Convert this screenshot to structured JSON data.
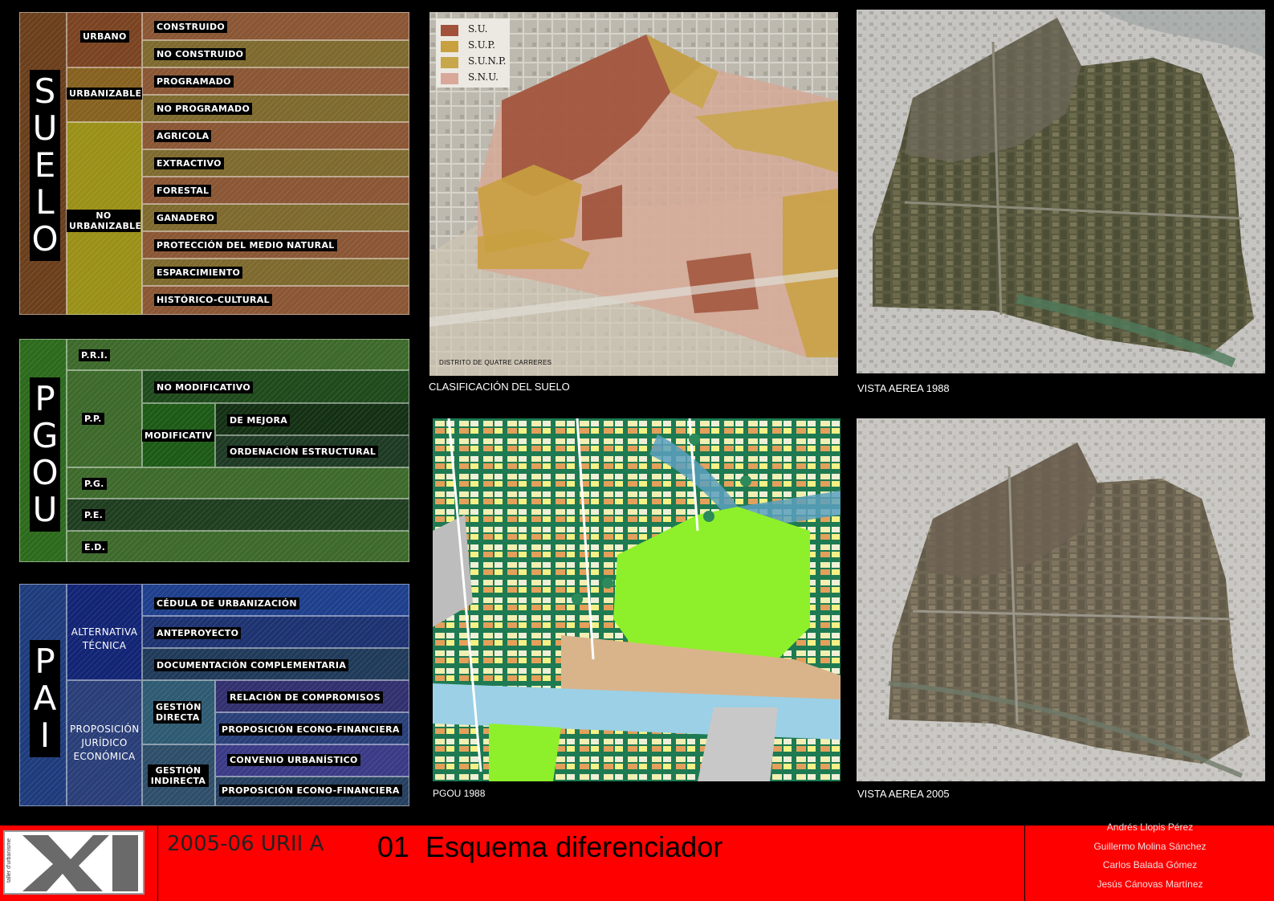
{
  "suelo": {
    "title_letters": [
      "S",
      "U",
      "E",
      "L",
      "O"
    ],
    "groups": [
      "URBANO",
      "URBANIZABLE",
      "NO URBANIZABLE"
    ],
    "items": [
      "CONSTRUIDO",
      "NO CONSTRUIDO",
      "PROGRAMADO",
      "NO PROGRAMADO",
      "AGRICOLA",
      "EXTRACTIVO",
      "FORESTAL",
      "GANADERO",
      "PROTECCIÓN DEL MEDIO NATURAL",
      "ESPARCIMIENTO",
      "HISTÓRICO-CULTURAL"
    ]
  },
  "pgou": {
    "title_letters": [
      "P",
      "G",
      "O",
      "U"
    ],
    "rows": [
      "P.R.I.",
      "P.P.",
      "P.G.",
      "P.E.",
      "E.D."
    ],
    "no_modificativo": "NO MODIFICATIVO",
    "modificativ": "MODIFICATIV",
    "de_mejora": "DE MEJORA",
    "ordenacion": "ORDENACIÓN ESTRUCTURAL"
  },
  "pai": {
    "title_letters": [
      "P",
      "A",
      "I"
    ],
    "alternativa": "ALTERNATIVA TÉCNICA",
    "proposicion": "PROPOSICIÓN JURÍDICO ECONÓMICA",
    "gestion_directa": "GESTIÓN DIRECTA",
    "gestion_indirecta": "GESTIÓN INDIRECTA",
    "items": [
      "CÉDULA DE URBANIZACIÓN",
      "ANTEPROYECTO",
      "DOCUMENTACIÓN COMPLEMENTARIA",
      "RELACIÓN DE COMPROMISOS",
      "PROPOSICIÓN ECONO-FINANCIERA",
      "CONVENIO URBANÍSTICO",
      "PROPOSICIÓN ECONO-FINANCIERA"
    ]
  },
  "maps": {
    "clasificacion": {
      "caption": "CLASIFICACIÓN DEL SUELO",
      "legend": [
        "S.U.",
        "S.U.P.",
        "S.U.N.P.",
        "S.N.U."
      ],
      "legend_colors": [
        "#a0523a",
        "#c9a040",
        "#c8a64a",
        "#d9a89a"
      ],
      "district": "DISTRITO DE QUATRE CARRERES"
    },
    "vista_1988": "VISTA AEREA 1988",
    "pgou_1988": "PGOU 1988",
    "vista_2005": "VISTA AEREA 2005"
  },
  "footer": {
    "logo_side_text": "taller d'urbanisme",
    "course": "2005-06 URII A",
    "number": "01",
    "title": "Esquema diferenciador",
    "authors": [
      "Andrés Llopis Pérez",
      "Guillermo Molina Sánchez",
      "Carlos Balada Gómez",
      "Jesús Cánovas Martínez"
    ]
  }
}
